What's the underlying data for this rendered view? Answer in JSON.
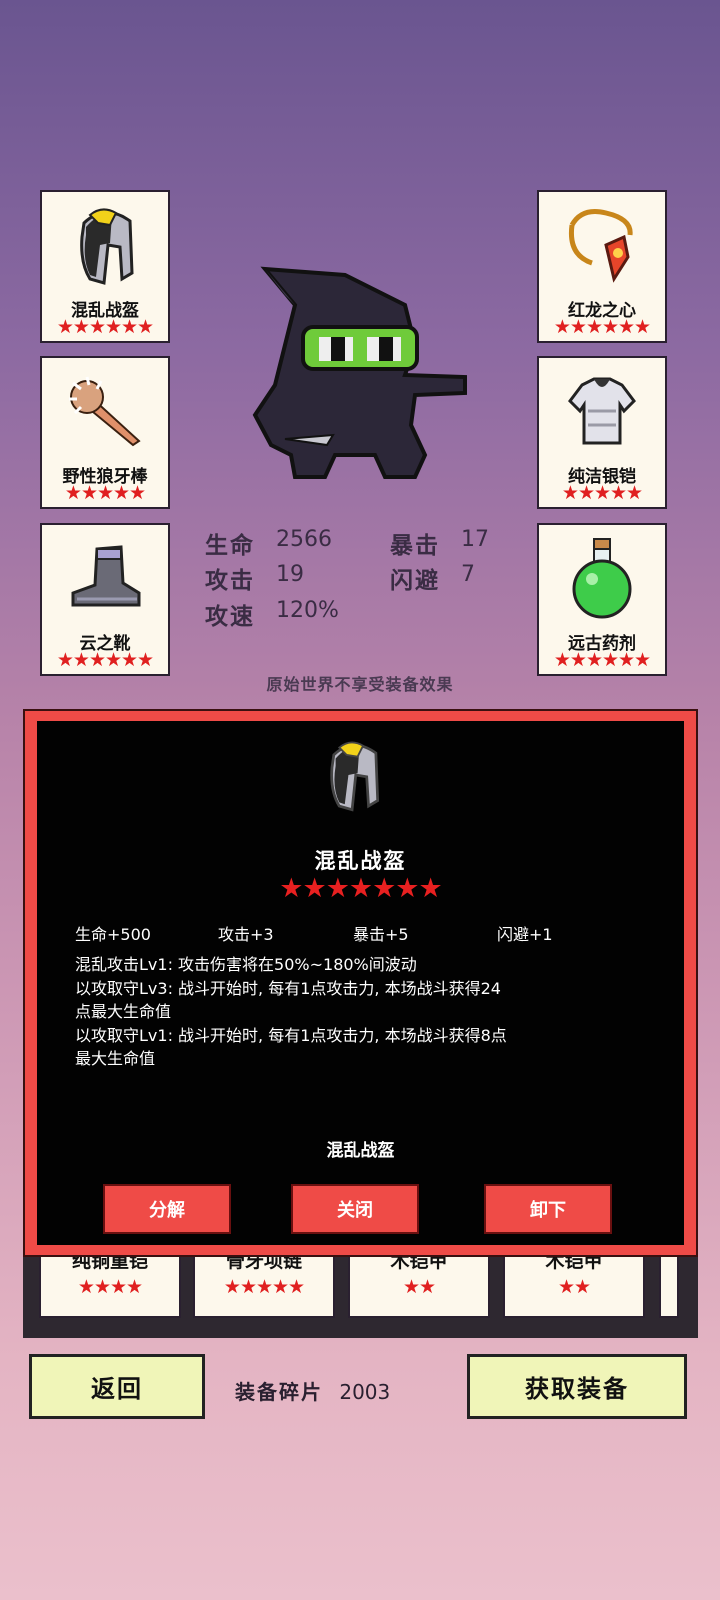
{
  "equipment_slots": {
    "left": [
      {
        "name": "混乱战盔",
        "stars": "★★★★★★",
        "icon": "helmet-icon"
      },
      {
        "name": "野性狼牙棒",
        "stars": "★★★★★",
        "icon": "club-icon"
      },
      {
        "name": "云之靴",
        "stars": "★★★★★★",
        "icon": "boots-icon"
      }
    ],
    "right": [
      {
        "name": "红龙之心",
        "stars": "★★★★★★",
        "icon": "amulet-icon"
      },
      {
        "name": "纯洁银铠",
        "stars": "★★★★★",
        "icon": "armor-icon"
      },
      {
        "name": "远古药剂",
        "stars": "★★★★★★",
        "icon": "potion-icon"
      }
    ]
  },
  "stats": {
    "hp_label": "生命",
    "hp": "2566",
    "crit_label": "暴击",
    "crit": "17",
    "atk_label": "攻击",
    "atk": "19",
    "dodge_label": "闪避",
    "dodge": "7",
    "speed_label": "攻速",
    "speed": "120%"
  },
  "notice": "原始世界不享受装备效果",
  "inventory": [
    {
      "name": "纯铜重铠",
      "stars": "★★★★"
    },
    {
      "name": "骨牙项链",
      "stars": "★★★★★"
    },
    {
      "name": "木铠甲",
      "stars": "★★"
    },
    {
      "name": "木铠甲",
      "stars": "★★"
    }
  ],
  "detail": {
    "title": "混乱战盔",
    "stars": "★★★★★★★",
    "stat_lines": [
      "生命+500",
      "攻击+3",
      "暴击+5",
      "闪避+1"
    ],
    "desc_lines": [
      "混乱攻击Lv1: 攻击伤害将在50%~180%间波动",
      "以攻取守Lv3: 战斗开始时, 每有1点攻击力, 本场战斗获得24",
      "点最大生命值",
      "以攻取守Lv1: 战斗开始时, 每有1点攻击力, 本场战斗获得8点",
      "最大生命值"
    ],
    "footer_name": "混乱战盔",
    "buttons": {
      "decompose": "分解",
      "close": "关闭",
      "unequip": "卸下"
    }
  },
  "bottom": {
    "back": "返回",
    "fragments_label": "装备碎片",
    "fragments_value": "2003",
    "get": "获取装备"
  },
  "colors": {
    "accent_red": "#ef4b47",
    "star_red": "#e02020",
    "button_yellow": "#f0f5b8"
  }
}
